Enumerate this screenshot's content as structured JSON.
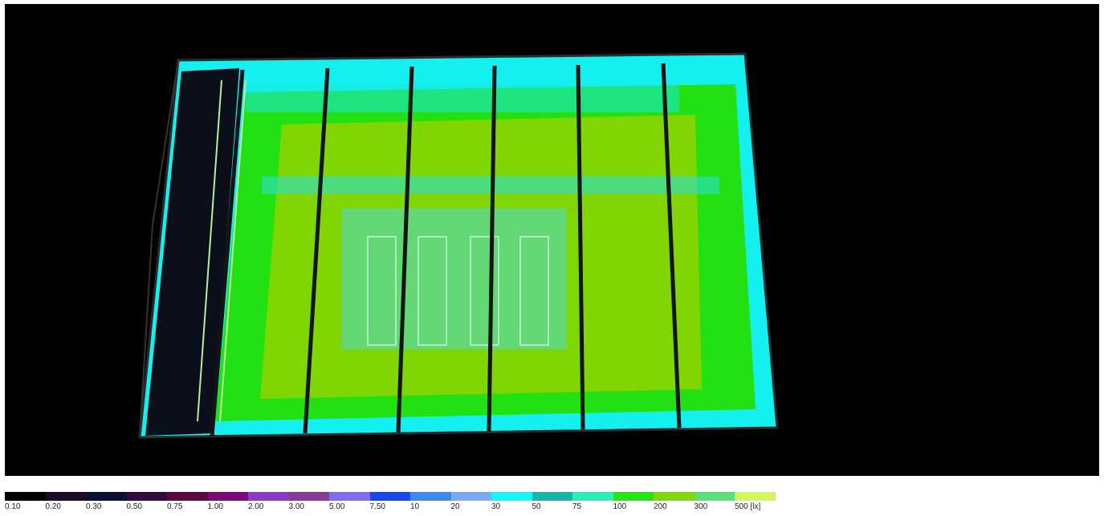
{
  "legend": {
    "ticks": [
      "0.10",
      "0.20",
      "0.30",
      "0.50",
      "0.75",
      "1.00",
      "2.00",
      "3.00",
      "5.00",
      "7.50",
      "10",
      "20",
      "30",
      "50",
      "75",
      "100",
      "200",
      "300",
      "500 [lx]"
    ],
    "colors": [
      "#000000",
      "#1a0a24",
      "#08113a",
      "#330a40",
      "#5a0a3c",
      "#7a0a7a",
      "#8a3ac8",
      "#8a3a9a",
      "#7f6cf0",
      "#1648f0",
      "#3c8af0",
      "#78a8f8",
      "#10f8f8",
      "#10b8a8",
      "#28f0b8",
      "#20e810",
      "#80d800",
      "#58e078",
      "#d0f858"
    ]
  },
  "scene": {
    "background": "#000000",
    "floor_color": "#7ed600",
    "mid_zone_color": "#20e010",
    "edge_color": "#12f4f4",
    "beam_color": "#141414",
    "equipment_color": "#5ed888"
  }
}
